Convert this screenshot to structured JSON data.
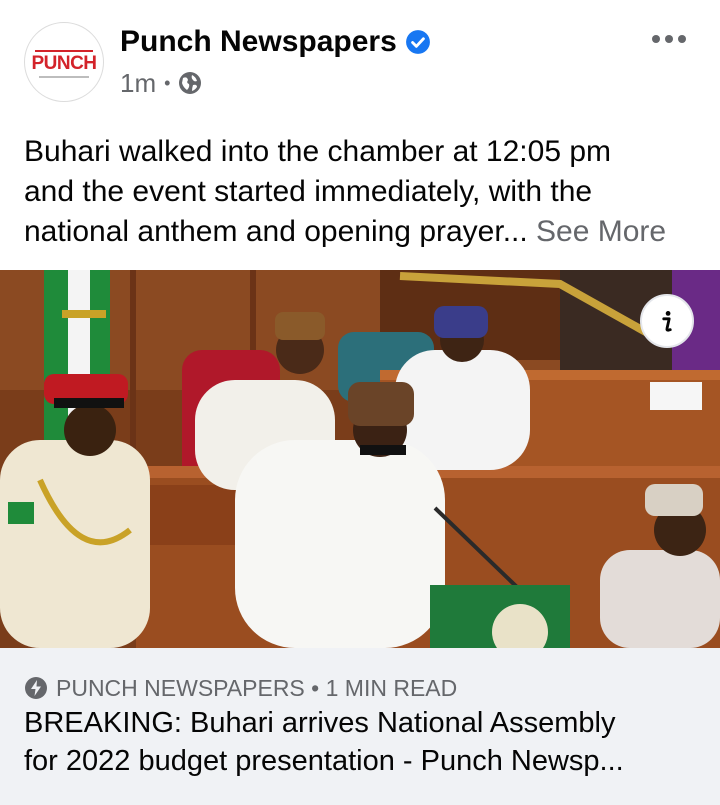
{
  "post": {
    "page_name": "Punch Newspapers",
    "avatar_text": "PUNCH",
    "timestamp": "1m",
    "separator": "•",
    "audience_icon": "globe-icon",
    "verified_icon": "verified-badge-icon",
    "more_icon": "more-options-icon",
    "text_line1": "Buhari walked into the chamber at 12:05 pm",
    "text_line2": "and the event started immediately, with the",
    "text_line3": "national anthem and opening prayer...",
    "see_more": "See More"
  },
  "photo": {
    "info_icon": "info-icon",
    "info_label": "i"
  },
  "link_card": {
    "source_icon": "bolt-icon",
    "source": "PUNCH NEWSPAPERS • 1 MIN READ",
    "title_line1": "BREAKING: Buhari arrives National Assembly",
    "title_line2": "for 2022 budget presentation - Punch Newsp..."
  },
  "colors": {
    "primary_text": "#050505",
    "secondary_text": "#65676b",
    "verified_blue": "#1877f2",
    "brand_red": "#d3232a",
    "card_bg": "#f0f2f5"
  }
}
